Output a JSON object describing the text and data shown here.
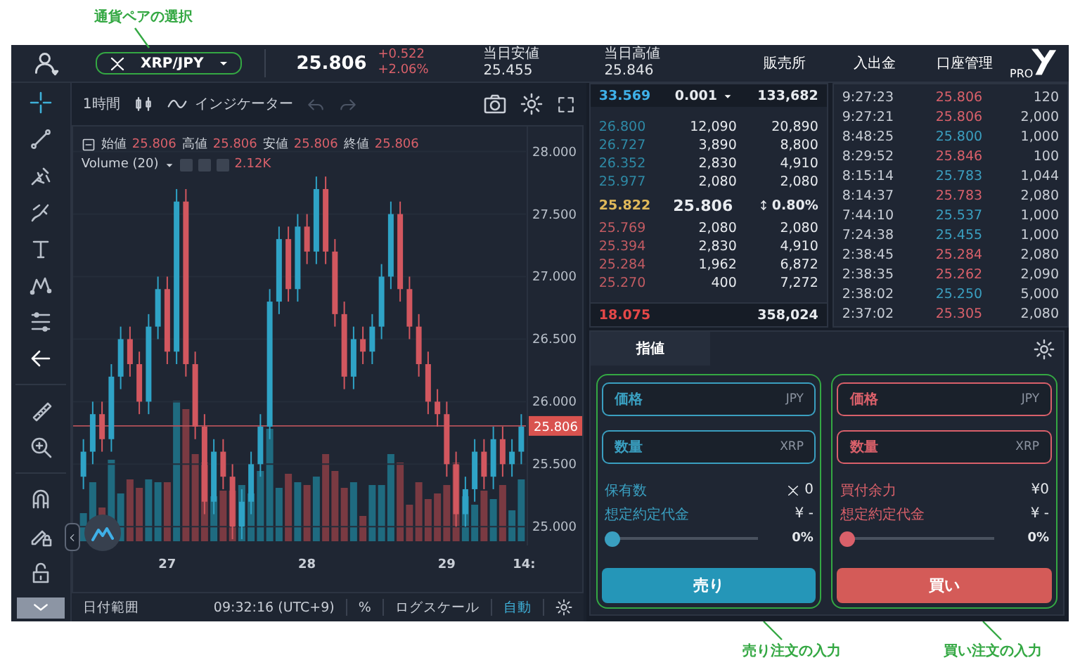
{
  "annotations": {
    "pair_select": "通貨ペアの選択",
    "sell_input": "売り注文の入力",
    "buy_input": "買い注文の入力"
  },
  "header": {
    "pair": "XRP/JPY",
    "price": "25.806",
    "change": "+0.522",
    "change_pct": "+2.06%",
    "low_label": "当日安値",
    "low": "25.455",
    "high_label": "当日高値",
    "high": "25.846",
    "nav": [
      "販売所",
      "入出金",
      "口座管理"
    ],
    "logo_text": "PRO"
  },
  "chart": {
    "interval": "1時間",
    "indicator": "インジケーター",
    "ohlc": [
      {
        "label": "始値",
        "value": "25.806"
      },
      {
        "label": "高値",
        "value": "25.806"
      },
      {
        "label": "安値",
        "value": "25.806"
      },
      {
        "label": "終値",
        "value": "25.806"
      }
    ],
    "volume_label": "Volume (20)",
    "volume_value": "2.12K",
    "chart_data": {
      "type": "candlestick",
      "categories": [
        null,
        null,
        null,
        null,
        null,
        null,
        null,
        null,
        null,
        "27",
        null,
        null,
        null,
        null,
        null,
        null,
        null,
        null,
        null,
        null,
        null,
        null,
        null,
        null,
        "28",
        null,
        null,
        null,
        null,
        null,
        null,
        null,
        null,
        null,
        null,
        null,
        null,
        null,
        null,
        "29",
        null,
        null,
        null,
        null,
        null,
        null,
        null,
        null
      ],
      "ohlc": [
        [
          25.4,
          25.7,
          25.3,
          25.6
        ],
        [
          25.6,
          26.0,
          25.5,
          25.9
        ],
        [
          25.9,
          26.0,
          25.6,
          25.7
        ],
        [
          25.7,
          26.3,
          25.6,
          26.2
        ],
        [
          26.2,
          26.6,
          26.1,
          26.5
        ],
        [
          26.5,
          26.6,
          26.2,
          26.3
        ],
        [
          26.3,
          26.4,
          25.9,
          26.0
        ],
        [
          26.0,
          26.7,
          25.9,
          26.6
        ],
        [
          26.6,
          27.0,
          26.5,
          26.9
        ],
        [
          26.9,
          27.0,
          26.3,
          26.4
        ],
        [
          26.4,
          27.7,
          26.3,
          27.6
        ],
        [
          27.6,
          27.7,
          26.2,
          26.3
        ],
        [
          26.3,
          26.4,
          25.7,
          25.8
        ],
        [
          25.8,
          25.9,
          25.1,
          25.2
        ],
        [
          25.2,
          25.7,
          25.1,
          25.6
        ],
        [
          25.6,
          25.7,
          25.3,
          25.4
        ],
        [
          25.4,
          25.5,
          24.9,
          25.0
        ],
        [
          25.0,
          25.3,
          24.9,
          25.2
        ],
        [
          25.2,
          25.6,
          25.1,
          25.5
        ],
        [
          25.5,
          25.9,
          25.4,
          25.8
        ],
        [
          25.8,
          26.9,
          25.7,
          26.8
        ],
        [
          26.8,
          27.4,
          26.7,
          27.3
        ],
        [
          27.3,
          27.4,
          26.8,
          26.9
        ],
        [
          26.9,
          27.5,
          26.8,
          27.4
        ],
        [
          27.4,
          27.5,
          27.1,
          27.2
        ],
        [
          27.2,
          27.8,
          27.1,
          27.7
        ],
        [
          27.7,
          27.8,
          27.1,
          27.2
        ],
        [
          27.2,
          27.3,
          26.6,
          26.7
        ],
        [
          26.7,
          26.8,
          26.1,
          26.2
        ],
        [
          26.2,
          26.6,
          26.1,
          26.5
        ],
        [
          26.5,
          26.6,
          26.3,
          26.4
        ],
        [
          26.4,
          26.7,
          26.3,
          26.6
        ],
        [
          26.6,
          27.1,
          26.5,
          27.0
        ],
        [
          27.0,
          27.6,
          26.9,
          27.5
        ],
        [
          27.5,
          27.6,
          26.8,
          26.9
        ],
        [
          26.9,
          27.0,
          26.5,
          26.6
        ],
        [
          26.6,
          26.7,
          26.2,
          26.3
        ],
        [
          26.3,
          26.4,
          25.9,
          26.0
        ],
        [
          26.0,
          26.1,
          25.8,
          25.9
        ],
        [
          25.9,
          26.0,
          25.4,
          25.5
        ],
        [
          25.5,
          25.6,
          25.0,
          25.1
        ],
        [
          25.1,
          25.4,
          25.0,
          25.3
        ],
        [
          25.3,
          25.7,
          25.2,
          25.6
        ],
        [
          25.6,
          25.7,
          25.3,
          25.4
        ],
        [
          25.4,
          25.8,
          25.3,
          25.7
        ],
        [
          25.7,
          25.8,
          25.4,
          25.5
        ],
        [
          25.5,
          25.7,
          25.4,
          25.6
        ],
        [
          25.6,
          25.9,
          25.5,
          25.8
        ]
      ],
      "ylim": [
        24.85,
        28.2
      ],
      "grid": true,
      "yticks": [
        {
          "value": 28,
          "label": "28.000"
        },
        {
          "value": 27.5,
          "label": "27.500"
        },
        {
          "value": 27,
          "label": "27.000"
        },
        {
          "value": 26.5,
          "label": "26.500"
        },
        {
          "value": 26,
          "label": "26.000"
        },
        {
          "value": 25.5,
          "label": "25.500"
        },
        {
          "value": 25,
          "label": "25.000"
        }
      ]
    },
    "current_price": "25.806",
    "edge_time_label": "14:",
    "footer": {
      "range": "日付範囲",
      "time": "09:32:16 (UTC+9)",
      "percent": "%",
      "log": "ログスケール",
      "auto": "自動"
    }
  },
  "order_book": {
    "top": {
      "price": "33.569",
      "step": "0.001",
      "total": "133,682"
    },
    "asks": [
      {
        "price": "26.800",
        "amount": "12,090",
        "total": "20,890"
      },
      {
        "price": "26.727",
        "amount": "3,890",
        "total": "8,800"
      },
      {
        "price": "26.352",
        "amount": "2,830",
        "total": "4,910"
      },
      {
        "price": "25.977",
        "amount": "2,080",
        "total": "2,080"
      }
    ],
    "mid": {
      "price": "25.822",
      "last": "25.806",
      "spread": "0.80%"
    },
    "bids": [
      {
        "price": "25.769",
        "amount": "2,080",
        "total": "2,080"
      },
      {
        "price": "25.394",
        "amount": "2,830",
        "total": "4,910"
      },
      {
        "price": "25.284",
        "amount": "1,962",
        "total": "6,872"
      },
      {
        "price": "25.270",
        "amount": "400",
        "total": "7,272"
      }
    ],
    "bottom": {
      "price": "18.075",
      "total": "358,024"
    }
  },
  "trades": [
    {
      "time": "9:27:23",
      "price": "25.806",
      "amount": "120",
      "color": "#d9606a"
    },
    {
      "time": "9:27:21",
      "price": "25.806",
      "amount": "2,000",
      "color": "#d9606a"
    },
    {
      "time": "8:48:25",
      "price": "25.800",
      "amount": "1,000",
      "color": "#3a9fc0"
    },
    {
      "time": "8:29:52",
      "price": "25.846",
      "amount": "100",
      "color": "#d9606a"
    },
    {
      "time": "8:15:14",
      "price": "25.783",
      "amount": "1,044",
      "color": "#3a9fc0"
    },
    {
      "time": "8:14:37",
      "price": "25.783",
      "amount": "2,080",
      "color": "#d9606a"
    },
    {
      "time": "7:44:10",
      "price": "25.537",
      "amount": "1,000",
      "color": "#3a9fc0"
    },
    {
      "time": "7:24:38",
      "price": "25.455",
      "amount": "1,000",
      "color": "#3a9fc0"
    },
    {
      "time": "2:38:45",
      "price": "25.284",
      "amount": "2,080",
      "color": "#d9606a"
    },
    {
      "time": "2:38:35",
      "price": "25.262",
      "amount": "2,090",
      "color": "#d9606a"
    },
    {
      "time": "2:38:02",
      "price": "25.250",
      "amount": "5,000",
      "color": "#3a9fc0"
    },
    {
      "time": "2:37:02",
      "price": "25.305",
      "amount": "2,080",
      "color": "#d9606a"
    }
  ],
  "order_tab": "指値",
  "order_forms": [
    {
      "kind": "sell",
      "price_field": {
        "placeholder": "価格",
        "unit": "JPY"
      },
      "qty_field": {
        "placeholder": "数量",
        "unit": "XRP"
      },
      "info": [
        {
          "kind": "coin",
          "label": "保有数",
          "value": "0"
        },
        {
          "kind": "plain",
          "label": "想定約定代金",
          "value": "¥ -"
        }
      ],
      "level": 0,
      "percent": "0%",
      "button": "売り"
    },
    {
      "kind": "buy",
      "price_field": {
        "placeholder": "価格",
        "unit": "JPY"
      },
      "qty_field": {
        "placeholder": "数量",
        "unit": "XRP"
      },
      "info": [
        {
          "kind": "plain",
          "label": "買付余力",
          "value": "¥0"
        },
        {
          "kind": "plain",
          "label": "想定約定代金",
          "value": "¥ -"
        }
      ],
      "level": 0,
      "percent": "0%",
      "button": "買い"
    }
  ]
}
